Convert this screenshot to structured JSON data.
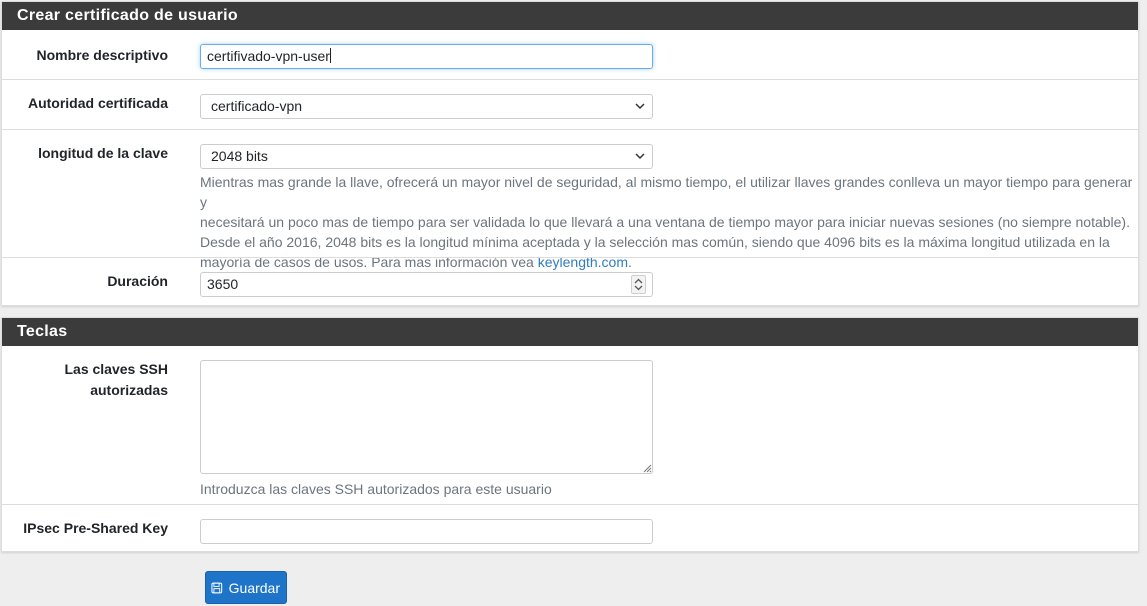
{
  "panel1": {
    "title": "Crear certificado de usuario",
    "descriptive_name": {
      "label": "Nombre descriptivo",
      "value": "certifivado-vpn-user"
    },
    "authority": {
      "label": "Autoridad certificada",
      "value": "certificado-vpn"
    },
    "key_length": {
      "label": "longitud de la clave",
      "value": "2048 bits",
      "help_line1": "Mientras mas grande la llave, ofrecerá un mayor nivel de seguridad, al mismo tiempo, el utilizar llaves grandes conlleva un mayor tiempo para generar y",
      "help_line2": "necesitará un poco mas de tiempo para ser validada lo que llevará a una ventana de tiempo mayor para iniciar nuevas sesiones (no siempre notable).",
      "help_line3": "Desde el año 2016, 2048 bits es la longitud mínima aceptada y la selección mas común, siendo que 4096 bits es la máxima longitud utilizada en la",
      "help_line4_prefix": "mayoría de casos de usos. Para mas información vea ",
      "help_link": "keylength.com",
      "help_line4_suffix": "."
    },
    "duration": {
      "label": "Duración",
      "value": "3650"
    }
  },
  "panel2": {
    "title": "Teclas",
    "ssh_keys": {
      "label_line1": "Las claves SSH",
      "label_line2": "autorizadas",
      "value": "",
      "help": "Introduzca las claves SSH autorizados para este usuario"
    },
    "ipsec": {
      "label": "IPsec Pre-Shared Key",
      "value": ""
    }
  },
  "save_button": {
    "label": "Guardar"
  },
  "colors": {
    "heading_bg": "#3b3b3b",
    "primary": "#1e74c9",
    "link": "#317cc0",
    "focus": "#66afe9"
  }
}
